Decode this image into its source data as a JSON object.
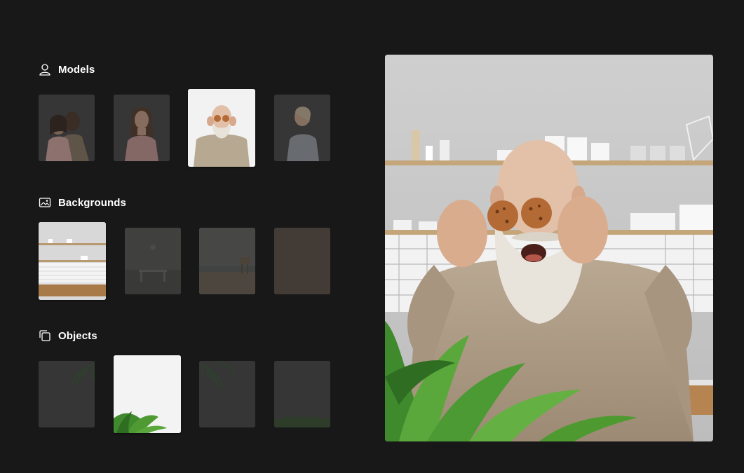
{
  "sections": {
    "models": {
      "title": "Models",
      "icon": "person-icon"
    },
    "backgrounds": {
      "title": "Backgrounds",
      "icon": "image-icon"
    },
    "objects": {
      "title": "Objects",
      "icon": "layers-icon"
    }
  },
  "selection": {
    "model": "old-man-with-cookies",
    "background": "kitchen",
    "object": "potted-plant"
  }
}
